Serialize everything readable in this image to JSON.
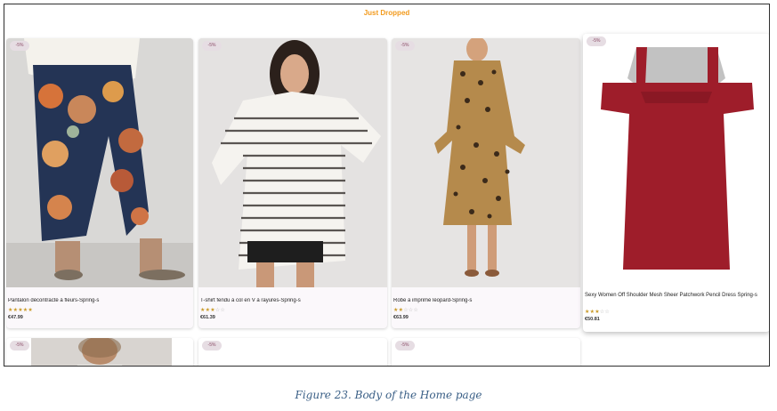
{
  "section_title": "Just Dropped",
  "colors": {
    "accent": "#f29a1c",
    "caption": "#3a5f86",
    "dress_red": "#9e1d2a"
  },
  "products": [
    {
      "badge": "-5%",
      "name": "Pantalon décontracté à fleurs-Spring-s",
      "rating": 5,
      "price": "€47.99"
    },
    {
      "badge": "-5%",
      "name": "T-shirt fendu à col en V à rayures-Spring-s",
      "rating": 3,
      "price": "€61.39"
    },
    {
      "badge": "-5%",
      "name": "Robe à imprimé léopard-Spring-s",
      "rating": 2,
      "price": "€63.99"
    },
    {
      "badge": "-5%",
      "name": "Sexy Women Off Shoulder Mesh Sheer Patchwork Pencil Dress Spring-s",
      "rating": 3,
      "price": "€50.81"
    },
    {
      "badge": "-5%"
    },
    {
      "badge": "-5%"
    },
    {
      "badge": "-5%"
    }
  ],
  "caption": "Figure 23. Body of the Home page"
}
